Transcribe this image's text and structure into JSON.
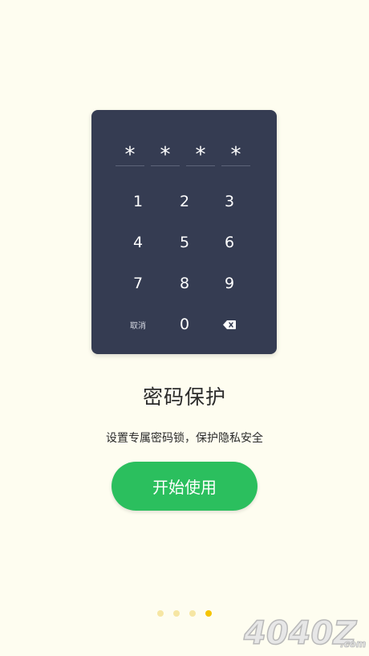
{
  "keypad": {
    "pin_slots": [
      "*",
      "*",
      "*",
      "*"
    ],
    "keys": [
      "1",
      "2",
      "3",
      "4",
      "5",
      "6",
      "7",
      "8",
      "9"
    ],
    "cancel_label": "取消",
    "zero_label": "0"
  },
  "intro": {
    "title": "密码保护",
    "subtitle": "设置专属密码锁，保护隐私安全",
    "start_button_label": "开始使用"
  },
  "pager": {
    "total": 4,
    "active_index": 3
  },
  "watermark": {
    "text": "4040Z",
    "suffix": ".com"
  },
  "colors": {
    "background": "#fefdf0",
    "keypad": "#353c52",
    "button": "#2bbf5e",
    "dot_active": "#f5c400",
    "dot_inactive": "#f6e6a3"
  }
}
